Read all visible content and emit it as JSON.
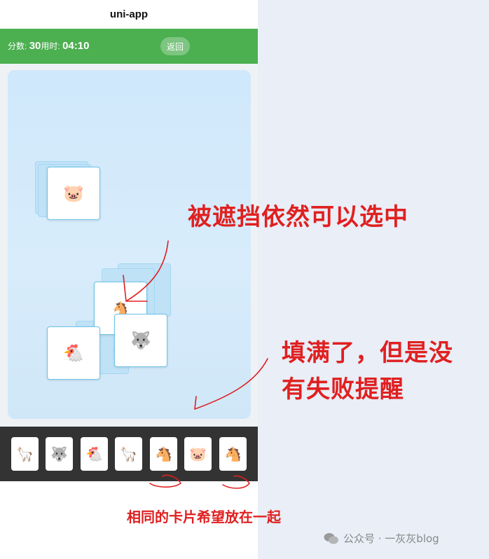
{
  "app": {
    "title": "uni-app"
  },
  "topbar": {
    "score_label": "分数:",
    "score_value": "30",
    "time_label": "用时:",
    "time_value": "04:10",
    "back_label": "返回"
  },
  "board": {
    "cards": [
      {
        "emoji": "🐷",
        "state": "top"
      },
      {
        "emoji": "🐴",
        "state": "top"
      },
      {
        "emoji": "🐺",
        "state": "top"
      },
      {
        "emoji": "🐔",
        "state": "top"
      },
      {
        "emoji": "🐑",
        "state": "covered"
      }
    ]
  },
  "slots": [
    "🦙",
    "🐺",
    "🐔",
    "🦙",
    "🐴",
    "🐷",
    "🐴"
  ],
  "annotations": {
    "covered": "被遮挡依然可以选中",
    "full_line1": "填满了，但是没",
    "full_line2": "有失败提醒",
    "same": "相同的卡片希望放在一起"
  },
  "watermark": {
    "text": "公众号 · 一灰灰blog"
  },
  "colors": {
    "topbar": "#4caf50",
    "annotation": "#e02020",
    "slot_bar": "#333333"
  }
}
